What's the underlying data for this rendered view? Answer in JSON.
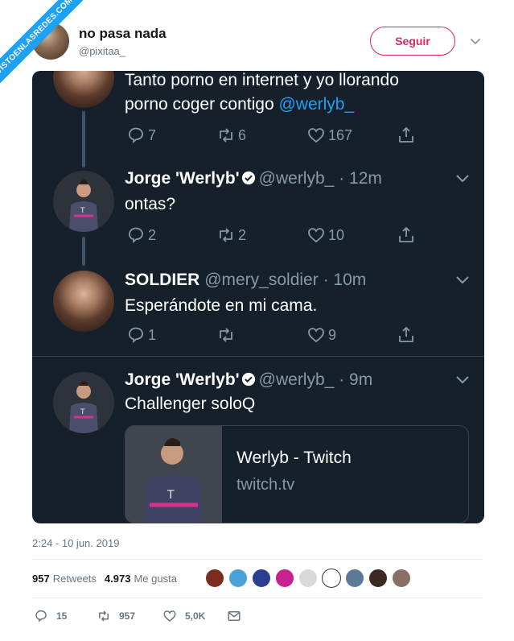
{
  "watermark": "VISTOENLASREDES.COM",
  "author": {
    "name": "no pasa nada",
    "handle": "@pixitaa_"
  },
  "follow_label": "Seguir",
  "embedded": {
    "tweet1": {
      "text_line1": "Tanto porno en internet y yo llorando",
      "text_line2": "porno coger contigo",
      "mention": "@werlyb_",
      "replies": "7",
      "retweets": "6",
      "likes": "167"
    },
    "tweet2": {
      "name": "Jorge 'Werlyb'",
      "handle": "@werlyb_",
      "time": "· 12m",
      "text": "ontas?",
      "replies": "2",
      "retweets": "2",
      "likes": "10"
    },
    "tweet3": {
      "name": "SOLDIER",
      "handle": "@mery_soldier",
      "time": "· 10m",
      "text": "Esperándote en mi cama.",
      "replies": "1",
      "retweets": "",
      "likes": "9"
    },
    "tweet4": {
      "name": "Jorge 'Werlyb'",
      "handle": "@werlyb_",
      "time": "· 9m",
      "text": "Challenger soloQ",
      "card_title": "Werlyb - Twitch",
      "card_domain": "twitch.tv"
    }
  },
  "timestamp": "2:24 - 10 jun. 2019",
  "stats": {
    "retweets_count": "957",
    "retweets_label": "Retweets",
    "likes_count": "4.973",
    "likes_label": "Me gusta"
  },
  "bottom_actions": {
    "replies": "15",
    "retweets": "957",
    "likes": "5,0K"
  },
  "icons": {
    "reply": "reply-icon",
    "retweet": "retweet-icon",
    "like": "heart-icon",
    "share": "share-icon",
    "dm": "mail-icon",
    "verified": "verified-badge-icon"
  },
  "colors": {
    "accent": "#1da1f2",
    "follow": "#e0245e",
    "dark_bg": "#15202b",
    "muted": "#8899a6"
  }
}
